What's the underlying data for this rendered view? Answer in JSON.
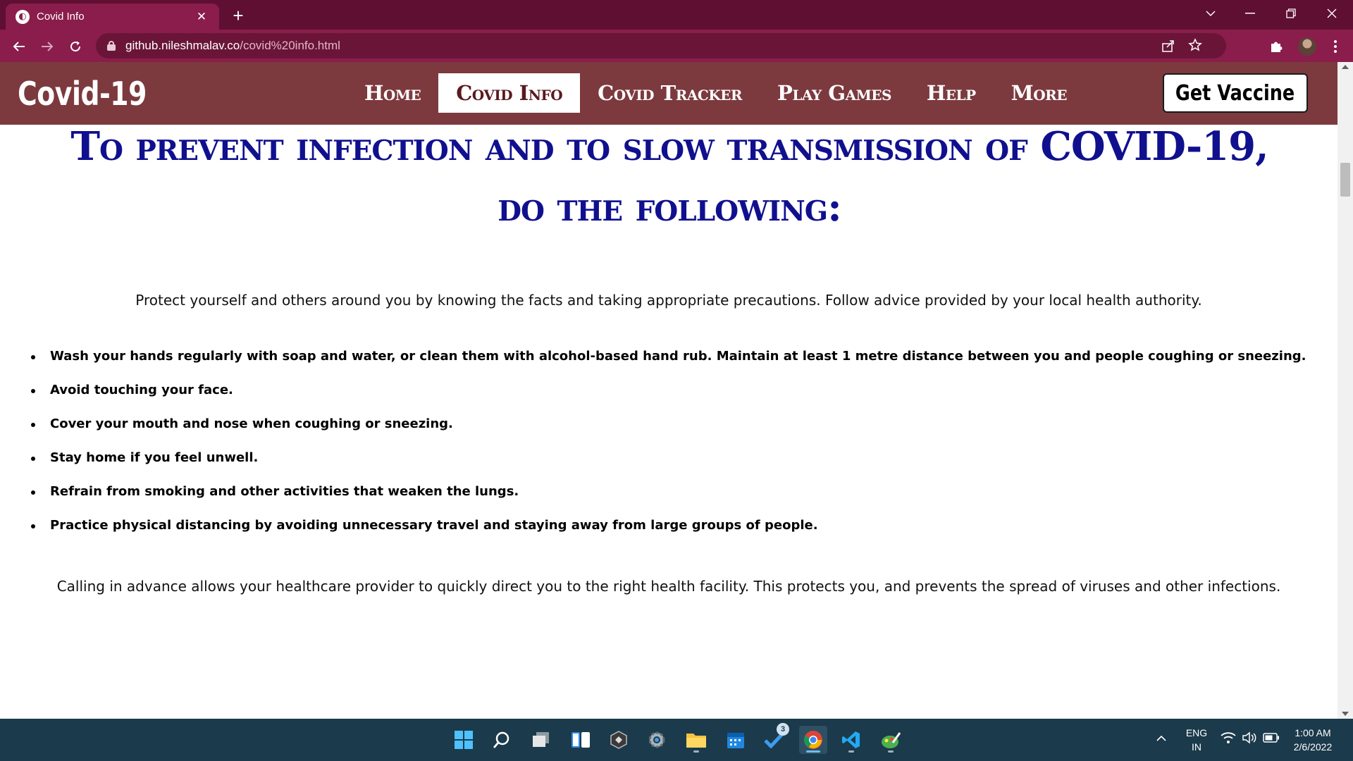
{
  "browser": {
    "tab_title": "Covid Info",
    "url_host": "github.nileshmalav.co",
    "url_path": "/covid%20info.html"
  },
  "navbar": {
    "brand": "Covid-19",
    "links": [
      "Home",
      "Covid Info",
      "Covid Tracker",
      "Play Games",
      "Help",
      "More"
    ],
    "active_link": "Covid Info",
    "cta": "Get Vaccine"
  },
  "main": {
    "heading": "To prevent infection and to slow transmission of COVID-19, do the following:",
    "intro": "Protect yourself and others around you by knowing the facts and taking appropriate precautions. Follow advice provided by your local health authority.",
    "tips": [
      "Wash your hands regularly with soap and water, or clean them with alcohol-based hand rub. Maintain at least 1 metre distance between you and people coughing or sneezing.",
      "Avoid touching your face.",
      "Cover your mouth and nose when coughing or sneezing.",
      "Stay home if you feel unwell.",
      "Refrain from smoking and other activities that weaken the lungs.",
      "Practice physical distancing by avoiding unnecessary travel and staying away from large groups of people."
    ],
    "outro": "Calling in advance allows your healthcare provider to quickly direct you to the right health facility. This protects you, and prevents the spread of viruses and other infections."
  },
  "taskbar": {
    "todo_badge": "3",
    "language": "ENG",
    "region": "IN",
    "time": "1:00 AM",
    "date": "2/6/2022"
  },
  "colors": {
    "tab_strip": "#5f0f32",
    "toolbar": "#8a1d4b",
    "navbar": "#7c3a3e",
    "heading": "#10108f",
    "taskbar": "#1b3a4b"
  }
}
